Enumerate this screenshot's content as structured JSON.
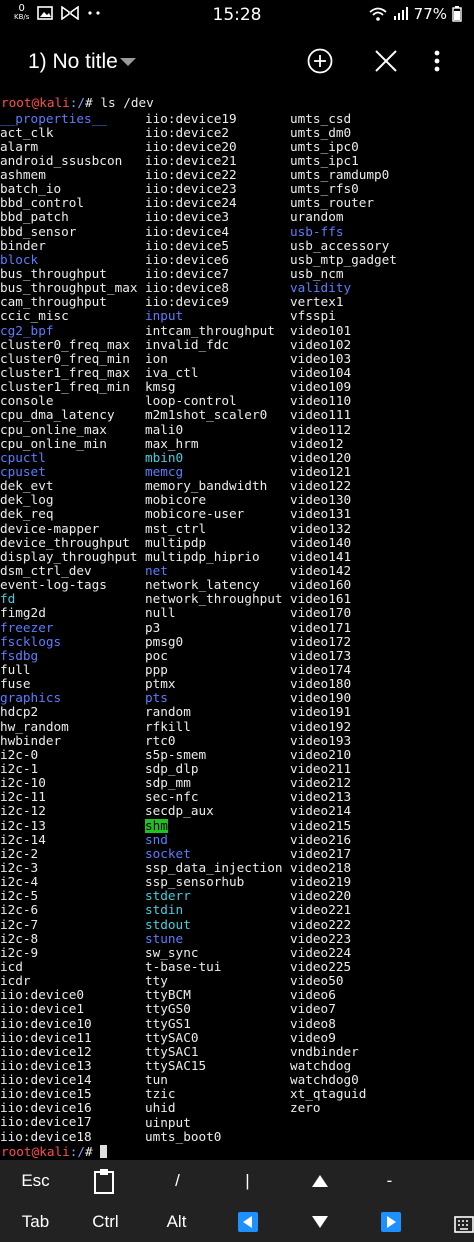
{
  "status_bar": {
    "speed_value": "0",
    "speed_unit": "KB/s",
    "time": "15:28",
    "battery": "77%",
    "icons": [
      "image-icon",
      "bowtie-icon",
      "more-dots-icon",
      "wifi-icon",
      "signal-icon",
      "battery-icon"
    ]
  },
  "app_bar": {
    "title": "1) No title",
    "actions": [
      "add-session-icon",
      "close-session-icon",
      "overflow-menu-icon"
    ]
  },
  "terminal": {
    "prompt_user": "root@kali",
    "prompt_path": ":/",
    "prompt_symbol": "# ",
    "command": "ls /dev",
    "columns": [
      [
        {
          "t": "__properties__",
          "c": "dir"
        },
        {
          "t": "act_clk",
          "c": "plain"
        },
        {
          "t": "alarm",
          "c": "plain"
        },
        {
          "t": "android_ssusbcon",
          "c": "plain"
        },
        {
          "t": "ashmem",
          "c": "plain"
        },
        {
          "t": "batch_io",
          "c": "plain"
        },
        {
          "t": "bbd_control",
          "c": "plain"
        },
        {
          "t": "bbd_patch",
          "c": "plain"
        },
        {
          "t": "bbd_sensor",
          "c": "plain"
        },
        {
          "t": "binder",
          "c": "plain"
        },
        {
          "t": "block",
          "c": "dir"
        },
        {
          "t": "bus_throughput",
          "c": "plain"
        },
        {
          "t": "bus_throughput_max",
          "c": "plain"
        },
        {
          "t": "cam_throughput",
          "c": "plain"
        },
        {
          "t": "ccic_misc",
          "c": "plain"
        },
        {
          "t": "cg2_bpf",
          "c": "dir"
        },
        {
          "t": "cluster0_freq_max",
          "c": "plain"
        },
        {
          "t": "cluster0_freq_min",
          "c": "plain"
        },
        {
          "t": "cluster1_freq_max",
          "c": "plain"
        },
        {
          "t": "cluster1_freq_min",
          "c": "plain"
        },
        {
          "t": "console",
          "c": "plain"
        },
        {
          "t": "cpu_dma_latency",
          "c": "plain"
        },
        {
          "t": "cpu_online_max",
          "c": "plain"
        },
        {
          "t": "cpu_online_min",
          "c": "plain"
        },
        {
          "t": "cpuctl",
          "c": "dir"
        },
        {
          "t": "cpuset",
          "c": "dir"
        },
        {
          "t": "dek_evt",
          "c": "plain"
        },
        {
          "t": "dek_log",
          "c": "plain"
        },
        {
          "t": "dek_req",
          "c": "plain"
        },
        {
          "t": "device-mapper",
          "c": "plain"
        },
        {
          "t": "device_throughput",
          "c": "plain"
        },
        {
          "t": "display_throughput",
          "c": "plain"
        },
        {
          "t": "dsm_ctrl_dev",
          "c": "plain"
        },
        {
          "t": "event-log-tags",
          "c": "plain"
        },
        {
          "t": "fd",
          "c": "link"
        },
        {
          "t": "fimg2d",
          "c": "plain"
        },
        {
          "t": "freezer",
          "c": "dir"
        },
        {
          "t": "fscklogs",
          "c": "dir"
        },
        {
          "t": "fsdbg",
          "c": "dir"
        },
        {
          "t": "full",
          "c": "plain"
        },
        {
          "t": "fuse",
          "c": "plain"
        },
        {
          "t": "graphics",
          "c": "dir"
        },
        {
          "t": "hdcp2",
          "c": "plain"
        },
        {
          "t": "hw_random",
          "c": "plain"
        },
        {
          "t": "hwbinder",
          "c": "plain"
        },
        {
          "t": "i2c-0",
          "c": "plain"
        },
        {
          "t": "i2c-1",
          "c": "plain"
        },
        {
          "t": "i2c-10",
          "c": "plain"
        },
        {
          "t": "i2c-11",
          "c": "plain"
        },
        {
          "t": "i2c-12",
          "c": "plain"
        },
        {
          "t": "i2c-13",
          "c": "plain"
        },
        {
          "t": "i2c-14",
          "c": "plain"
        },
        {
          "t": "i2c-2",
          "c": "plain"
        },
        {
          "t": "i2c-3",
          "c": "plain"
        },
        {
          "t": "i2c-4",
          "c": "plain"
        },
        {
          "t": "i2c-5",
          "c": "plain"
        },
        {
          "t": "i2c-6",
          "c": "plain"
        },
        {
          "t": "i2c-7",
          "c": "plain"
        },
        {
          "t": "i2c-8",
          "c": "plain"
        },
        {
          "t": "i2c-9",
          "c": "plain"
        },
        {
          "t": "icd",
          "c": "plain"
        },
        {
          "t": "icdr",
          "c": "plain"
        },
        {
          "t": "iio:device0",
          "c": "plain"
        },
        {
          "t": "iio:device1",
          "c": "plain"
        },
        {
          "t": "iio:device10",
          "c": "plain"
        },
        {
          "t": "iio:device11",
          "c": "plain"
        },
        {
          "t": "iio:device12",
          "c": "plain"
        },
        {
          "t": "iio:device13",
          "c": "plain"
        },
        {
          "t": "iio:device14",
          "c": "plain"
        },
        {
          "t": "iio:device15",
          "c": "plain"
        },
        {
          "t": "iio:device16",
          "c": "plain"
        },
        {
          "t": "iio:device17",
          "c": "plain"
        },
        {
          "t": "iio:device18",
          "c": "plain"
        }
      ],
      [
        {
          "t": "iio:device19",
          "c": "plain"
        },
        {
          "t": "iio:device2",
          "c": "plain"
        },
        {
          "t": "iio:device20",
          "c": "plain"
        },
        {
          "t": "iio:device21",
          "c": "plain"
        },
        {
          "t": "iio:device22",
          "c": "plain"
        },
        {
          "t": "iio:device23",
          "c": "plain"
        },
        {
          "t": "iio:device24",
          "c": "plain"
        },
        {
          "t": "iio:device3",
          "c": "plain"
        },
        {
          "t": "iio:device4",
          "c": "plain"
        },
        {
          "t": "iio:device5",
          "c": "plain"
        },
        {
          "t": "iio:device6",
          "c": "plain"
        },
        {
          "t": "iio:device7",
          "c": "plain"
        },
        {
          "t": "iio:device8",
          "c": "plain"
        },
        {
          "t": "iio:device9",
          "c": "plain"
        },
        {
          "t": "input",
          "c": "dir"
        },
        {
          "t": "intcam_throughput",
          "c": "plain"
        },
        {
          "t": "invalid_fdc",
          "c": "plain"
        },
        {
          "t": "ion",
          "c": "plain"
        },
        {
          "t": "iva_ctl",
          "c": "plain"
        },
        {
          "t": "kmsg",
          "c": "plain"
        },
        {
          "t": "loop-control",
          "c": "plain"
        },
        {
          "t": "m2m1shot_scaler0",
          "c": "plain"
        },
        {
          "t": "mali0",
          "c": "plain"
        },
        {
          "t": "max_hrm",
          "c": "plain"
        },
        {
          "t": "mbin0",
          "c": "link"
        },
        {
          "t": "memcg",
          "c": "dir"
        },
        {
          "t": "memory_bandwidth",
          "c": "plain"
        },
        {
          "t": "mobicore",
          "c": "plain"
        },
        {
          "t": "mobicore-user",
          "c": "plain"
        },
        {
          "t": "mst_ctrl",
          "c": "plain"
        },
        {
          "t": "multipdp",
          "c": "plain"
        },
        {
          "t": "multipdp_hiprio",
          "c": "plain"
        },
        {
          "t": "net",
          "c": "dir"
        },
        {
          "t": "network_latency",
          "c": "plain"
        },
        {
          "t": "network_throughput",
          "c": "plain"
        },
        {
          "t": "null",
          "c": "plain"
        },
        {
          "t": "p3",
          "c": "plain"
        },
        {
          "t": "pmsg0",
          "c": "plain"
        },
        {
          "t": "poc",
          "c": "plain"
        },
        {
          "t": "ppp",
          "c": "plain"
        },
        {
          "t": "ptmx",
          "c": "plain"
        },
        {
          "t": "pts",
          "c": "dir"
        },
        {
          "t": "random",
          "c": "plain"
        },
        {
          "t": "rfkill",
          "c": "plain"
        },
        {
          "t": "rtc0",
          "c": "plain"
        },
        {
          "t": "s5p-smem",
          "c": "plain"
        },
        {
          "t": "sdp_dlp",
          "c": "plain"
        },
        {
          "t": "sdp_mm",
          "c": "plain"
        },
        {
          "t": "sec-nfc",
          "c": "plain"
        },
        {
          "t": "secdp_aux",
          "c": "plain"
        },
        {
          "t": "shm",
          "c": "hl"
        },
        {
          "t": "snd",
          "c": "dir"
        },
        {
          "t": "socket",
          "c": "dir"
        },
        {
          "t": "ssp_data_injection",
          "c": "plain"
        },
        {
          "t": "ssp_sensorhub",
          "c": "plain"
        },
        {
          "t": "stderr",
          "c": "link"
        },
        {
          "t": "stdin",
          "c": "link"
        },
        {
          "t": "stdout",
          "c": "link"
        },
        {
          "t": "stune",
          "c": "dir"
        },
        {
          "t": "sw_sync",
          "c": "plain"
        },
        {
          "t": "t-base-tui",
          "c": "plain"
        },
        {
          "t": "tty",
          "c": "plain"
        },
        {
          "t": "ttyBCM",
          "c": "plain"
        },
        {
          "t": "ttyGS0",
          "c": "plain"
        },
        {
          "t": "ttyGS1",
          "c": "plain"
        },
        {
          "t": "ttySAC0",
          "c": "plain"
        },
        {
          "t": "ttySAC1",
          "c": "plain"
        },
        {
          "t": "ttySAC15",
          "c": "plain"
        },
        {
          "t": "tun",
          "c": "plain"
        },
        {
          "t": "tzic",
          "c": "plain"
        },
        {
          "t": "uhid",
          "c": "plain"
        },
        {
          "t": "uinput",
          "c": "plain"
        },
        {
          "t": "umts_boot0",
          "c": "plain"
        }
      ],
      [
        {
          "t": "umts_csd",
          "c": "plain"
        },
        {
          "t": "umts_dm0",
          "c": "plain"
        },
        {
          "t": "umts_ipc0",
          "c": "plain"
        },
        {
          "t": "umts_ipc1",
          "c": "plain"
        },
        {
          "t": "umts_ramdump0",
          "c": "plain"
        },
        {
          "t": "umts_rfs0",
          "c": "plain"
        },
        {
          "t": "umts_router",
          "c": "plain"
        },
        {
          "t": "urandom",
          "c": "plain"
        },
        {
          "t": "usb-ffs",
          "c": "dir"
        },
        {
          "t": "usb_accessory",
          "c": "plain"
        },
        {
          "t": "usb_mtp_gadget",
          "c": "plain"
        },
        {
          "t": "usb_ncm",
          "c": "plain"
        },
        {
          "t": "validity",
          "c": "dir"
        },
        {
          "t": "vertex1",
          "c": "plain"
        },
        {
          "t": "vfsspi",
          "c": "plain"
        },
        {
          "t": "video101",
          "c": "plain"
        },
        {
          "t": "video102",
          "c": "plain"
        },
        {
          "t": "video103",
          "c": "plain"
        },
        {
          "t": "video104",
          "c": "plain"
        },
        {
          "t": "video109",
          "c": "plain"
        },
        {
          "t": "video110",
          "c": "plain"
        },
        {
          "t": "video111",
          "c": "plain"
        },
        {
          "t": "video112",
          "c": "plain"
        },
        {
          "t": "video12",
          "c": "plain"
        },
        {
          "t": "video120",
          "c": "plain"
        },
        {
          "t": "video121",
          "c": "plain"
        },
        {
          "t": "video122",
          "c": "plain"
        },
        {
          "t": "video130",
          "c": "plain"
        },
        {
          "t": "video131",
          "c": "plain"
        },
        {
          "t": "video132",
          "c": "plain"
        },
        {
          "t": "video140",
          "c": "plain"
        },
        {
          "t": "video141",
          "c": "plain"
        },
        {
          "t": "video142",
          "c": "plain"
        },
        {
          "t": "video160",
          "c": "plain"
        },
        {
          "t": "video161",
          "c": "plain"
        },
        {
          "t": "video170",
          "c": "plain"
        },
        {
          "t": "video171",
          "c": "plain"
        },
        {
          "t": "video172",
          "c": "plain"
        },
        {
          "t": "video173",
          "c": "plain"
        },
        {
          "t": "video174",
          "c": "plain"
        },
        {
          "t": "video180",
          "c": "plain"
        },
        {
          "t": "video190",
          "c": "plain"
        },
        {
          "t": "video191",
          "c": "plain"
        },
        {
          "t": "video192",
          "c": "plain"
        },
        {
          "t": "video193",
          "c": "plain"
        },
        {
          "t": "video210",
          "c": "plain"
        },
        {
          "t": "video211",
          "c": "plain"
        },
        {
          "t": "video212",
          "c": "plain"
        },
        {
          "t": "video213",
          "c": "plain"
        },
        {
          "t": "video214",
          "c": "plain"
        },
        {
          "t": "video215",
          "c": "plain"
        },
        {
          "t": "video216",
          "c": "plain"
        },
        {
          "t": "video217",
          "c": "plain"
        },
        {
          "t": "video218",
          "c": "plain"
        },
        {
          "t": "video219",
          "c": "plain"
        },
        {
          "t": "video220",
          "c": "plain"
        },
        {
          "t": "video221",
          "c": "plain"
        },
        {
          "t": "video222",
          "c": "plain"
        },
        {
          "t": "video223",
          "c": "plain"
        },
        {
          "t": "video224",
          "c": "plain"
        },
        {
          "t": "video225",
          "c": "plain"
        },
        {
          "t": "video50",
          "c": "plain"
        },
        {
          "t": "video6",
          "c": "plain"
        },
        {
          "t": "video7",
          "c": "plain"
        },
        {
          "t": "video8",
          "c": "plain"
        },
        {
          "t": "video9",
          "c": "plain"
        },
        {
          "t": "vndbinder",
          "c": "plain"
        },
        {
          "t": "watchdog",
          "c": "plain"
        },
        {
          "t": "watchdog0",
          "c": "plain"
        },
        {
          "t": "xt_qtaguid",
          "c": "plain"
        },
        {
          "t": "zero",
          "c": "plain"
        }
      ]
    ]
  },
  "extra_keys": {
    "row1": [
      "Esc",
      "clipboard-icon",
      "/",
      "|",
      "up-arrow-icon",
      "-"
    ],
    "row2": [
      "Tab",
      "Ctrl",
      "Alt",
      "left-arrow-icon",
      "down-arrow-icon",
      "right-arrow-icon",
      "keyboard-icon"
    ],
    "labels": {
      "esc": "Esc",
      "slash": "/",
      "pipe": "|",
      "dash": "-",
      "tab": "Tab",
      "ctrl": "Ctrl",
      "alt": "Alt"
    }
  },
  "colors": {
    "prompt": "#ff4d4d",
    "directory": "#5b7cff",
    "symlink": "#3fd0e0",
    "highlight_bg": "#1fc21f",
    "keys_bg": "#222222",
    "left_arrow_key": "#1e90ff",
    "right_arrow_key": "#1e90ff"
  }
}
